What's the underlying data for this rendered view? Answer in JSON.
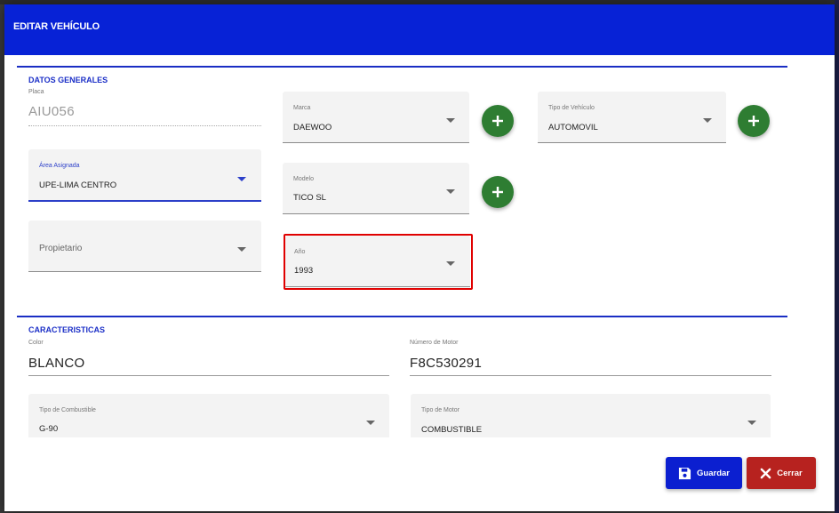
{
  "modal": {
    "title": "EDITAR VEHÍCULO"
  },
  "datos_generales": {
    "title": "DATOS GENERALES",
    "placa": {
      "label": "Placa",
      "value": "AIU056"
    },
    "marca": {
      "label": "Marca",
      "value": "DAEWOO"
    },
    "tipo_vehiculo": {
      "label": "Tipo de Vehículo",
      "value": "AUTOMOVIL"
    },
    "area_asignada": {
      "label": "Área Asignada",
      "value": "UPE-LIMA CENTRO"
    },
    "modelo": {
      "label": "Modelo",
      "value": "TICO SL"
    },
    "propietario": {
      "placeholder": "Propietario"
    },
    "anio": {
      "label": "Año",
      "value": "1993"
    }
  },
  "caracteristicas": {
    "title": "CARACTERISTICAS",
    "color": {
      "label": "Color",
      "value": "BLANCO"
    },
    "numero_motor": {
      "label": "Número de Motor",
      "value": "F8C530291"
    },
    "tipo_combustible": {
      "label": "Tipo de Combustible",
      "value": "G-90"
    },
    "tipo_motor": {
      "label": "Tipo de Motor",
      "value": "COMBUSTIBLE"
    }
  },
  "actions": {
    "save_label": "Guardar",
    "close_label": "Cerrar"
  },
  "icons": {
    "add": "plus-icon",
    "dropdown": "caret-down-icon",
    "save": "floppy-disk-icon",
    "close": "close-x-icon"
  },
  "colors": {
    "header": "#0722d6",
    "accent": "#1b2fc7",
    "fab_green": "#2e7d32",
    "save_button": "#0b1fd0",
    "close_button": "#b7221f",
    "highlight": "#e00000"
  }
}
